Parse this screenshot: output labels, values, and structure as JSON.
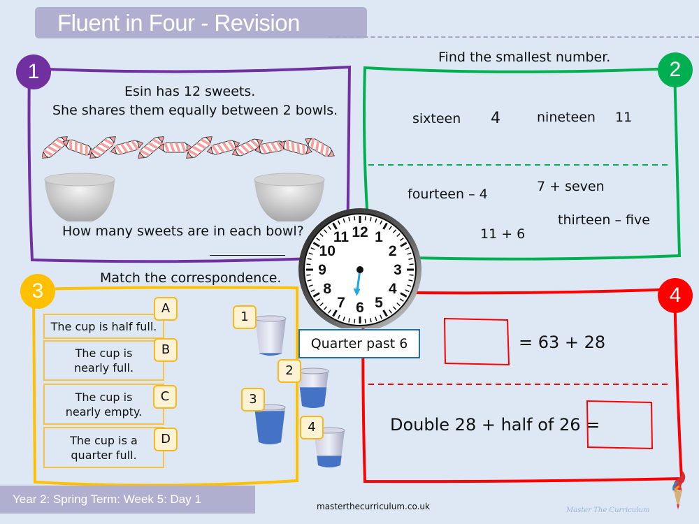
{
  "header": {
    "title": "Fluent in Four - Revision"
  },
  "colors": {
    "panel1": "#7030a0",
    "panel2": "#00b050",
    "panel3": "#ffc000",
    "panel4": "#ff0000",
    "header_bg": "#b1afcf",
    "background": "#dde8f4",
    "water": "#4472c4"
  },
  "panel1": {
    "badge": "1",
    "line1": "Esin has 12 sweets.",
    "line2": "She shares them equally between 2 bowls.",
    "question": "How many sweets are in each bowl?",
    "sweet_count": 12,
    "bowl_count": 2
  },
  "panel2": {
    "badge": "2",
    "instruction": "Find the smallest number.",
    "top_items": [
      "sixteen",
      "4",
      "nineteen",
      "11"
    ],
    "bottom_items": [
      "fourteen – 4",
      "7 + seven",
      "thirteen – five",
      "11 + 6"
    ]
  },
  "panel3": {
    "badge": "3",
    "instruction": "Match the correspondence.",
    "statements": [
      {
        "letter": "A",
        "text": "The cup is half full."
      },
      {
        "letter": "B",
        "text": "The cup is nearly full."
      },
      {
        "letter": "C",
        "text": "The cup is nearly empty."
      },
      {
        "letter": "D",
        "text": "The cup is a quarter full."
      }
    ],
    "cups": [
      {
        "number": "1",
        "fill": 0.05
      },
      {
        "number": "2",
        "fill": 0.55
      },
      {
        "number": "3",
        "fill": 0.9
      },
      {
        "number": "4",
        "fill": 0.3
      }
    ]
  },
  "clock": {
    "numbers": [
      "12",
      "1",
      "2",
      "3",
      "4",
      "5",
      "6",
      "7",
      "8",
      "9",
      "10",
      "11"
    ],
    "label": "Quarter past 6",
    "hand_hour_position": 6.25
  },
  "panel4": {
    "badge": "4",
    "equation1": "= 63 + 28",
    "equation2": "Double 28 + half of 26 ="
  },
  "footer": {
    "lesson": "Year 2: Spring Term: Week 5: Day 1",
    "site": "masterthecurriculum.co.uk",
    "brand": "Master The Curriculum"
  }
}
